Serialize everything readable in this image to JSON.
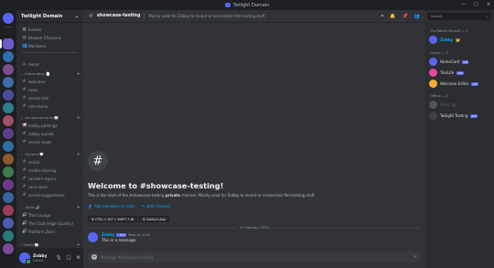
{
  "window": {
    "title": "Twilight Domain",
    "controls": [
      "—",
      "□",
      "✕"
    ]
  },
  "server": {
    "name": "Twilight Domain"
  },
  "sidebar": {
    "top_items": [
      {
        "icon": "calendar-icon",
        "glyph": "▦",
        "label": "Events"
      },
      {
        "icon": "browse-icon",
        "glyph": "▤",
        "label": "Browse Channels"
      },
      {
        "icon": "members-icon",
        "glyph": "👥",
        "label": "Members"
      }
    ],
    "home": {
      "glyph": "⌂",
      "label": "home"
    },
    "categories": [
      {
        "label": "Information 📄",
        "items": [
          {
            "glyph": "#",
            "label": "welcome"
          },
          {
            "glyph": "#",
            "label": "rules"
          },
          {
            "glyph": "#",
            "label": "server-info"
          },
          {
            "glyph": "#",
            "label": "role-menu"
          }
        ]
      },
      {
        "label": "Announcements 📰",
        "items": [
          {
            "glyph": "📢",
            "label": "zobby-postings"
          },
          {
            "glyph": "#",
            "label": "zobby-sunset"
          },
          {
            "glyph": "#",
            "label": "server-news"
          }
        ]
      },
      {
        "label": "General 💬",
        "items": [
          {
            "glyph": "#",
            "label": "social"
          },
          {
            "glyph": "#",
            "label": "media-sharing"
          },
          {
            "glyph": "#",
            "label": "random-topics"
          },
          {
            "glyph": "#",
            "label": "race-zone"
          },
          {
            "glyph": "#",
            "label": "server-suggestions"
          }
        ]
      },
      {
        "label": "Audio 🔊",
        "items": [
          {
            "glyph": "🔊",
            "label": "The Lounge"
          },
          {
            "glyph": "🔊",
            "label": "The Club (High Quality)"
          },
          {
            "glyph": "🔊",
            "label": "Platform Zero"
          }
        ]
      },
      {
        "label": "Feeds 📰",
        "items": []
      }
    ]
  },
  "user": {
    "name": "Zobby",
    "status": "Online"
  },
  "channel": {
    "name": "showcase-testing",
    "topic": "Mainly used for Zobby to record or screenshot film-testing stuff.",
    "welcome_title": "Welcome to #showcase-testing!",
    "welcome_pre": "This is the start of the #showcase-testing ",
    "welcome_bold": "private",
    "welcome_post": " channel. Mainly used for Zobby to record or screenshot film-testing stuff.",
    "add_members": "Add members or roles",
    "edit_channel": "Edit Channel",
    "tags": [
      "⊞ CTRL + ALT + SHIFT + ⊠",
      "⊞ Zobby's App"
    ],
    "date": "19 February 2025",
    "message": {
      "author": "Zobby",
      "badge": "✓ BOT",
      "time": "Today at 10:28",
      "text": "This is a message"
    },
    "composer_placeholder": "Message #showcase-testing"
  },
  "members": {
    "search_placeholder": "Search",
    "groups": [
      {
        "label": "The Robot Himself — 1",
        "members": [
          {
            "name": "Zobby",
            "color": "#00a8fc",
            "tag": "👑",
            "avatar": "#5865f2",
            "offline": false
          }
        ]
      },
      {
        "label": "Online — 3",
        "members": [
          {
            "name": "HomeCord",
            "color": "#dbdee1",
            "tag": "APP",
            "avatar": "#5865f2",
            "offline": false
          },
          {
            "name": "TikkLife",
            "color": "#dbdee1",
            "tag": "APP",
            "avatar": "#eb459e",
            "offline": false
          },
          {
            "name": "Welcome Editor",
            "color": "#dbdee1",
            "tag": "APP",
            "avatar": "#f0b232",
            "offline": false
          }
        ]
      },
      {
        "label": "Offline — 2",
        "members": [
          {
            "name": "Emoji.gg",
            "color": "#949ba4",
            "tag": "",
            "avatar": "#80848e",
            "offline": true
          },
          {
            "name": "Twilight Testing",
            "color": "#dbdee1",
            "tag": "APP",
            "avatar": "#3f4147",
            "offline": false
          }
        ]
      }
    ]
  },
  "colors": {
    "accent": "#5865f2",
    "link": "#00a8fc",
    "online": "#23a55a"
  }
}
